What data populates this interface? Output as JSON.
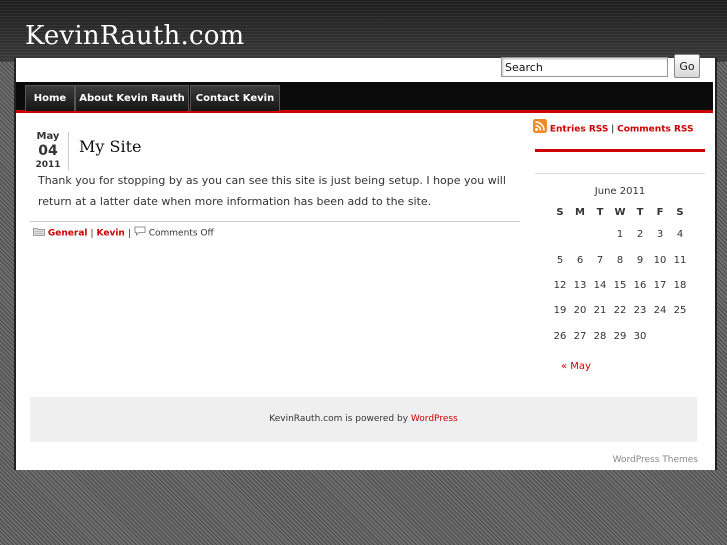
{
  "header": {
    "site_title": "KevinRauth.com",
    "search": {
      "value": "Search",
      "button_label": "Go"
    }
  },
  "nav": {
    "tabs": [
      {
        "label": "Home"
      },
      {
        "label": "About Kevin Rauth"
      },
      {
        "label": "Contact Kevin"
      }
    ]
  },
  "post": {
    "date": {
      "month": "May",
      "day": "04",
      "year": "2011"
    },
    "title": "My Site",
    "body": "Thank you for stopping by as you can see this site is just being setup. I hope you will return at a latter date when more information has been add to the site.",
    "meta": {
      "categories": [
        "General",
        "Kevin"
      ],
      "separator": "|",
      "comments": "Comments Off",
      "folder_icon": "folder-icon",
      "comment_icon": "comment-bubble-icon"
    }
  },
  "sidebar": {
    "rss_icon": "rss-feed-icon",
    "entries_rss": "Entries RSS",
    "separator": "|",
    "comments_rss": "Comments RSS",
    "calendar": {
      "caption": "June 2011",
      "weekdays": [
        "S",
        "M",
        "T",
        "W",
        "T",
        "F",
        "S"
      ],
      "weeks": [
        [
          "",
          "",
          "",
          "1",
          "2",
          "3",
          "4"
        ],
        [
          "5",
          "6",
          "7",
          "8",
          "9",
          "10",
          "11"
        ],
        [
          "12",
          "13",
          "14",
          "15",
          "16",
          "17",
          "18"
        ],
        [
          "19",
          "20",
          "21",
          "22",
          "23",
          "24",
          "25"
        ],
        [
          "26",
          "27",
          "28",
          "29",
          "30",
          "",
          ""
        ]
      ],
      "prev_link": "« May"
    }
  },
  "footer": {
    "text": "KevinRauth.com is powered by",
    "link": "WordPress"
  },
  "credit": "WordPress Themes",
  "colors": {
    "accent": "#cc0000",
    "nav_bg": "#0b0b0b",
    "header_bg": "#2a2a2a",
    "footer_bg": "#efefef"
  }
}
